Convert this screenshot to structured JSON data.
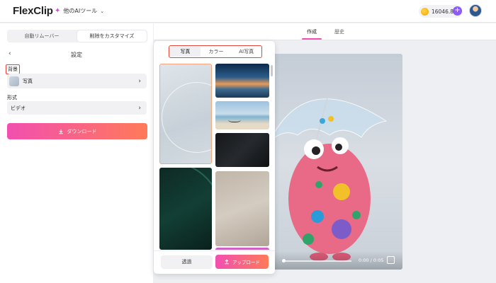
{
  "header": {
    "logo_main": "FlexClip",
    "tools_label": "他のAIツール",
    "credits": "16046.8",
    "plus": "+"
  },
  "left_panel": {
    "segments": [
      "自動リムーバー",
      "削除をカスタマイズ"
    ],
    "active_segment": 1,
    "back": "‹",
    "title": "設定",
    "background_label": "背景",
    "background_value": "写真",
    "format_label": "形式",
    "format_value": "ビデオ",
    "download_label": "ダウンロード"
  },
  "main": {
    "tabs": [
      "作成",
      "歴史"
    ],
    "active_tab": 0,
    "video": {
      "time": "0:00 / 0:05",
      "progress": 0.0
    }
  },
  "popup": {
    "tabs": [
      "写真",
      "カラー",
      "AI写真"
    ],
    "active_tab": 0,
    "transparent_label": "透過",
    "upload_label": "アップロード"
  },
  "icons": {
    "spark": "sparkle-icon",
    "chevron": "chevron-down-icon",
    "coin": "coin-icon",
    "download": "download-icon",
    "upload": "upload-icon",
    "fullscreen": "fullscreen-icon"
  },
  "colors": {
    "accent_start": "#f24fb0",
    "accent_end": "#ff7a59",
    "highlight": "#e3443a",
    "plus": "#8c5cf2"
  }
}
